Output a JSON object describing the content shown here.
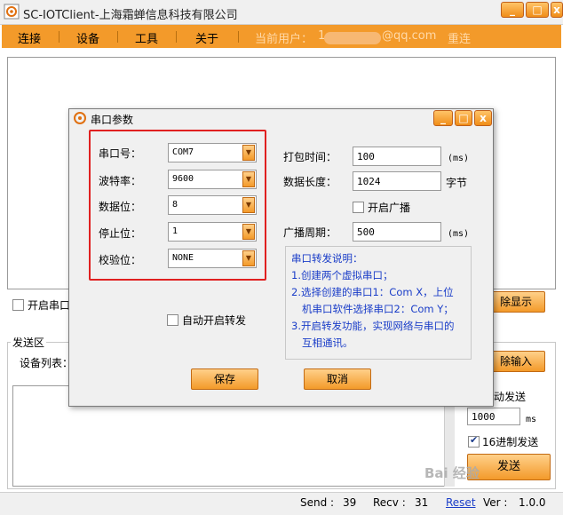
{
  "window": {
    "title": "SC-IOTClient-上海霜蝉信息科技有限公司",
    "buttons": [
      "_",
      "□",
      "x"
    ]
  },
  "menubar": {
    "items": [
      "连接",
      "设备",
      "工具",
      "关于"
    ],
    "current_user_label": "当前用户：",
    "current_user_value": "1",
    "current_user_suffix": "@qq.com",
    "reset": "重连"
  },
  "main": {
    "open_serial_checkbox": "开启串口",
    "clear_display_button": "除显示",
    "send_area_label": "发送区",
    "device_list_label": "设备列表：",
    "clear_input_button": "除输入",
    "auto_send_label": "动发送",
    "interval_value": "1000",
    "interval_unit": "ms",
    "hex_send_label": "16进制发送",
    "send_button": "发送"
  },
  "statusbar": {
    "send_label": "Send :",
    "send_value": "39",
    "recv_label": "Recv :",
    "recv_value": "31",
    "reset_link": "Reset",
    "version_label": "Ver :",
    "version_value": "1.0.0"
  },
  "watermark": "Bai 经验",
  "dialog": {
    "title": "串口参数",
    "fields": {
      "port_label": "串口号：",
      "port_value": "COM7",
      "baud_label": "波特率：",
      "baud_value": "9600",
      "databits_label": "数据位：",
      "databits_value": "8",
      "stopbits_label": "停止位：",
      "stopbits_value": "1",
      "parity_label": "校验位：",
      "parity_value": "NONE"
    },
    "pack_time_label": "打包时间：",
    "pack_time_value": "100",
    "pack_time_unit": "(ms)",
    "data_length_label": "数据长度：",
    "data_length_value": "1024",
    "data_length_unit": "字节",
    "broadcast_checkbox": "开启广播",
    "broadcast_period_label": "广播周期：",
    "broadcast_period_value": "500",
    "broadcast_period_unit": "(ms)",
    "auto_forward_checkbox": "自动开启转发",
    "forward_desc": {
      "title": "串口转发说明：",
      "line1": "1.创建两个虚拟串口；",
      "line2a": "2.选择创建的串口1：Com X，上位",
      "line2b": "机串口软件选择串口2：Com Y；",
      "line3a": "3.开启转发功能，实现网络与串口的",
      "line3b": "互相通讯。"
    },
    "save_button": "保存",
    "cancel_button": "取消"
  },
  "colors": {
    "accent_orange": "#f39a2a",
    "highlight_red": "#e02020",
    "desc_blue": "#1a3dc8"
  }
}
